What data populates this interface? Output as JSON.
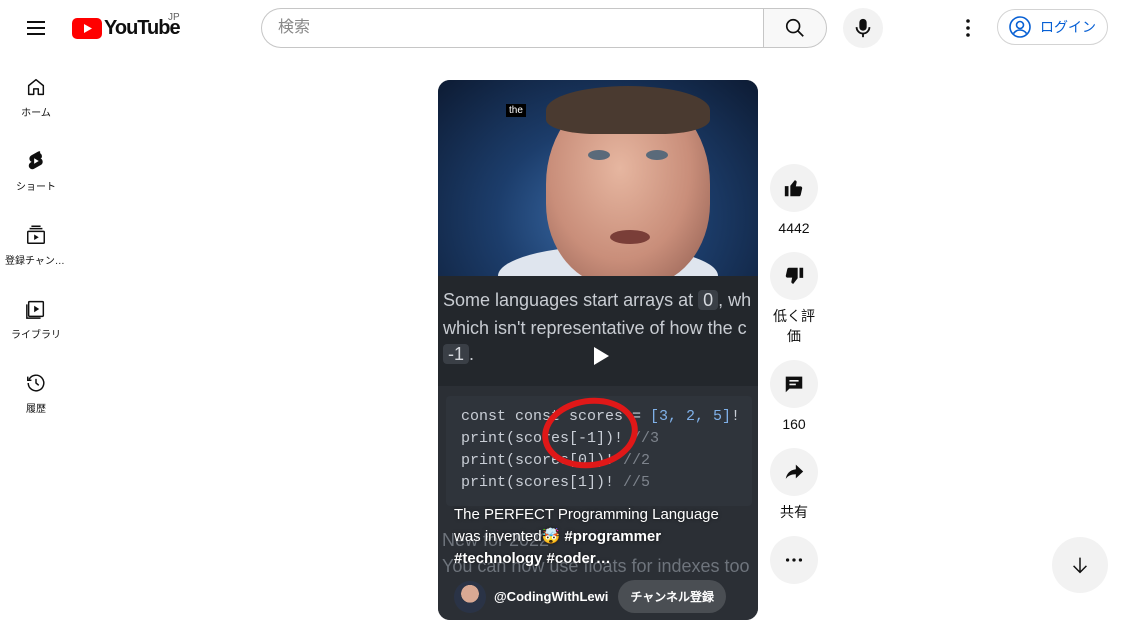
{
  "header": {
    "logo_text": "YouTube",
    "region": "JP",
    "search_placeholder": "検索",
    "search_value": "",
    "login_label": "ログイン"
  },
  "sidebar": {
    "items": [
      {
        "label": "ホーム",
        "icon": "home-icon"
      },
      {
        "label": "ショート",
        "icon": "shorts-icon"
      },
      {
        "label": "登録チャンネル",
        "icon": "subscriptions-icon"
      },
      {
        "label": "ライブラリ",
        "icon": "library-icon"
      },
      {
        "label": "履歴",
        "icon": "history-icon"
      }
    ]
  },
  "short": {
    "caption_chip": "the",
    "doc_lines": [
      "Some languages start arrays at",
      "0",
      ", wh",
      "which isn't representative of how the c",
      "-1",
      "."
    ],
    "code_lines": [
      {
        "code": "const const scores = ",
        "nums": "[3, 2, 5]",
        "tail": "!"
      },
      {
        "code": "print(scores[-1])!",
        "comment": "//3"
      },
      {
        "code": "print(scores[0])!",
        "comment": "//2"
      },
      {
        "code": "print(scores[1])!",
        "comment": "//5"
      }
    ],
    "bg_note_1": "New for 2022",
    "bg_note_2": "You can now use floats for indexes too",
    "title_text": "The PERFECT Programming Language was invented🤯",
    "title_tags": "#programmer #technology #coder…",
    "channel_name": "@CodingWithLewi",
    "subscribe_label": "チャンネル登録"
  },
  "actions": {
    "like_count": "4442",
    "dislike_label": "低く評価",
    "comment_count": "160",
    "share_label": "共有"
  }
}
